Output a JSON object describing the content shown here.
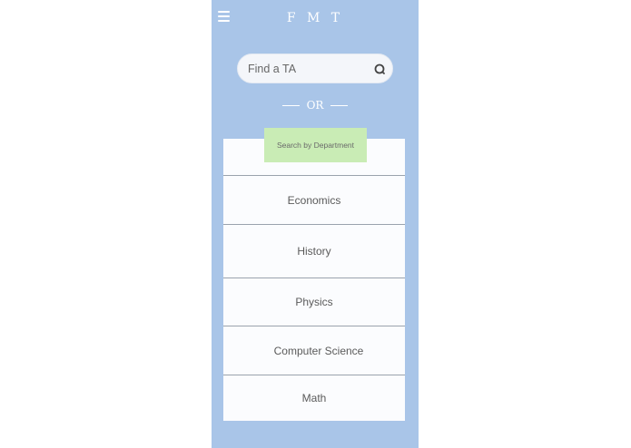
{
  "app": {
    "title": "F M T"
  },
  "search": {
    "placeholder": "Find a TA",
    "value": ""
  },
  "divider": {
    "label": "OR"
  },
  "department": {
    "button_label": "Search by Department",
    "items": [
      {
        "label": "Economics"
      },
      {
        "label": "History"
      },
      {
        "label": "Physics"
      },
      {
        "label": "Computer Science"
      },
      {
        "label": "Math"
      }
    ]
  },
  "colors": {
    "background": "#a9c5e8",
    "card": "#fbfcfe",
    "accent": "#c9ecb5"
  }
}
